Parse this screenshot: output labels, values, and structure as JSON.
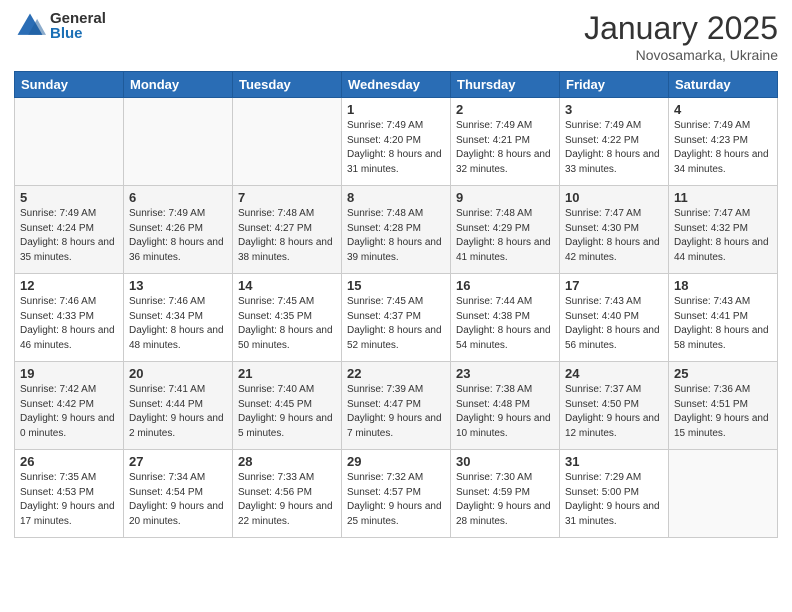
{
  "logo": {
    "general": "General",
    "blue": "Blue"
  },
  "header": {
    "month": "January 2025",
    "location": "Novosamarka, Ukraine"
  },
  "weekdays": [
    "Sunday",
    "Monday",
    "Tuesday",
    "Wednesday",
    "Thursday",
    "Friday",
    "Saturday"
  ],
  "weeks": [
    [
      {
        "day": "",
        "info": ""
      },
      {
        "day": "",
        "info": ""
      },
      {
        "day": "",
        "info": ""
      },
      {
        "day": "1",
        "info": "Sunrise: 7:49 AM\nSunset: 4:20 PM\nDaylight: 8 hours and 31 minutes."
      },
      {
        "day": "2",
        "info": "Sunrise: 7:49 AM\nSunset: 4:21 PM\nDaylight: 8 hours and 32 minutes."
      },
      {
        "day": "3",
        "info": "Sunrise: 7:49 AM\nSunset: 4:22 PM\nDaylight: 8 hours and 33 minutes."
      },
      {
        "day": "4",
        "info": "Sunrise: 7:49 AM\nSunset: 4:23 PM\nDaylight: 8 hours and 34 minutes."
      }
    ],
    [
      {
        "day": "5",
        "info": "Sunrise: 7:49 AM\nSunset: 4:24 PM\nDaylight: 8 hours and 35 minutes."
      },
      {
        "day": "6",
        "info": "Sunrise: 7:49 AM\nSunset: 4:26 PM\nDaylight: 8 hours and 36 minutes."
      },
      {
        "day": "7",
        "info": "Sunrise: 7:48 AM\nSunset: 4:27 PM\nDaylight: 8 hours and 38 minutes."
      },
      {
        "day": "8",
        "info": "Sunrise: 7:48 AM\nSunset: 4:28 PM\nDaylight: 8 hours and 39 minutes."
      },
      {
        "day": "9",
        "info": "Sunrise: 7:48 AM\nSunset: 4:29 PM\nDaylight: 8 hours and 41 minutes."
      },
      {
        "day": "10",
        "info": "Sunrise: 7:47 AM\nSunset: 4:30 PM\nDaylight: 8 hours and 42 minutes."
      },
      {
        "day": "11",
        "info": "Sunrise: 7:47 AM\nSunset: 4:32 PM\nDaylight: 8 hours and 44 minutes."
      }
    ],
    [
      {
        "day": "12",
        "info": "Sunrise: 7:46 AM\nSunset: 4:33 PM\nDaylight: 8 hours and 46 minutes."
      },
      {
        "day": "13",
        "info": "Sunrise: 7:46 AM\nSunset: 4:34 PM\nDaylight: 8 hours and 48 minutes."
      },
      {
        "day": "14",
        "info": "Sunrise: 7:45 AM\nSunset: 4:35 PM\nDaylight: 8 hours and 50 minutes."
      },
      {
        "day": "15",
        "info": "Sunrise: 7:45 AM\nSunset: 4:37 PM\nDaylight: 8 hours and 52 minutes."
      },
      {
        "day": "16",
        "info": "Sunrise: 7:44 AM\nSunset: 4:38 PM\nDaylight: 8 hours and 54 minutes."
      },
      {
        "day": "17",
        "info": "Sunrise: 7:43 AM\nSunset: 4:40 PM\nDaylight: 8 hours and 56 minutes."
      },
      {
        "day": "18",
        "info": "Sunrise: 7:43 AM\nSunset: 4:41 PM\nDaylight: 8 hours and 58 minutes."
      }
    ],
    [
      {
        "day": "19",
        "info": "Sunrise: 7:42 AM\nSunset: 4:42 PM\nDaylight: 9 hours and 0 minutes."
      },
      {
        "day": "20",
        "info": "Sunrise: 7:41 AM\nSunset: 4:44 PM\nDaylight: 9 hours and 2 minutes."
      },
      {
        "day": "21",
        "info": "Sunrise: 7:40 AM\nSunset: 4:45 PM\nDaylight: 9 hours and 5 minutes."
      },
      {
        "day": "22",
        "info": "Sunrise: 7:39 AM\nSunset: 4:47 PM\nDaylight: 9 hours and 7 minutes."
      },
      {
        "day": "23",
        "info": "Sunrise: 7:38 AM\nSunset: 4:48 PM\nDaylight: 9 hours and 10 minutes."
      },
      {
        "day": "24",
        "info": "Sunrise: 7:37 AM\nSunset: 4:50 PM\nDaylight: 9 hours and 12 minutes."
      },
      {
        "day": "25",
        "info": "Sunrise: 7:36 AM\nSunset: 4:51 PM\nDaylight: 9 hours and 15 minutes."
      }
    ],
    [
      {
        "day": "26",
        "info": "Sunrise: 7:35 AM\nSunset: 4:53 PM\nDaylight: 9 hours and 17 minutes."
      },
      {
        "day": "27",
        "info": "Sunrise: 7:34 AM\nSunset: 4:54 PM\nDaylight: 9 hours and 20 minutes."
      },
      {
        "day": "28",
        "info": "Sunrise: 7:33 AM\nSunset: 4:56 PM\nDaylight: 9 hours and 22 minutes."
      },
      {
        "day": "29",
        "info": "Sunrise: 7:32 AM\nSunset: 4:57 PM\nDaylight: 9 hours and 25 minutes."
      },
      {
        "day": "30",
        "info": "Sunrise: 7:30 AM\nSunset: 4:59 PM\nDaylight: 9 hours and 28 minutes."
      },
      {
        "day": "31",
        "info": "Sunrise: 7:29 AM\nSunset: 5:00 PM\nDaylight: 9 hours and 31 minutes."
      },
      {
        "day": "",
        "info": ""
      }
    ]
  ]
}
